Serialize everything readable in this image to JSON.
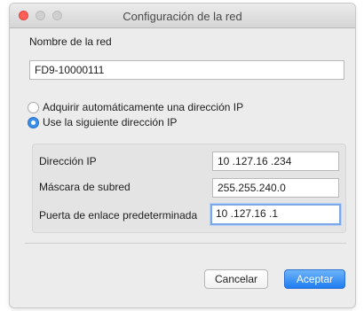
{
  "window": {
    "title": "Configuración de la red"
  },
  "network_name": {
    "label": "Nombre de la red",
    "value": "FD9-10000111"
  },
  "ip_mode": {
    "auto_label": "Adquirir automáticamente una dirección IP",
    "auto_selected": false,
    "manual_label": "Use la siguiente dirección IP",
    "manual_selected": true
  },
  "ip_settings": {
    "ip_address_label": "Dirección IP",
    "ip_address_value": "10 .127.16 .234",
    "subnet_mask_label": "Máscara de subred",
    "subnet_mask_value": "255.255.240.0",
    "gateway_label": "Puerta de enlace predeterminada",
    "gateway_value": "10 .127.16 .1"
  },
  "buttons": {
    "cancel_label": "Cancelar",
    "accept_label": "Aceptar"
  },
  "colors": {
    "accent": "#1f7df0",
    "close_light": "#ff5f57",
    "focus_ring": "#7fa9e6"
  }
}
